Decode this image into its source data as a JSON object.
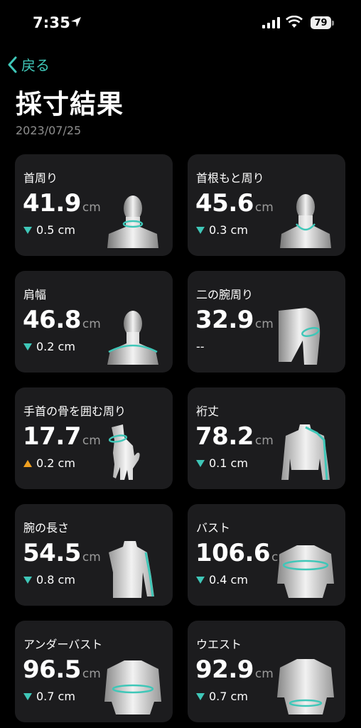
{
  "status_bar": {
    "time": "7:35",
    "battery": "79"
  },
  "nav": {
    "back_label": "戻る"
  },
  "page": {
    "title": "採寸結果",
    "date": "2023/07/25"
  },
  "colors": {
    "accent": "#3fc7b8",
    "up": "#f0a020",
    "card": "#1c1c1e"
  },
  "cards": [
    {
      "label": "首周り",
      "value": "41.9",
      "unit": "cm",
      "delta": "0.5 cm",
      "direction": "down",
      "figure": "head-neck"
    },
    {
      "label": "首根もと周り",
      "value": "45.6",
      "unit": "cm",
      "delta": "0.3 cm",
      "direction": "down",
      "figure": "head-neck-base"
    },
    {
      "label": "肩幅",
      "value": "46.8",
      "unit": "cm",
      "delta": "0.2 cm",
      "direction": "down",
      "figure": "head-shoulders"
    },
    {
      "label": "二の腕周り",
      "value": "32.9",
      "unit": "cm",
      "delta": "--",
      "direction": "none",
      "figure": "upper-arm"
    },
    {
      "label": "手首の骨を囲む周り",
      "value": "17.7",
      "unit": "cm",
      "delta": "0.2 cm",
      "direction": "up",
      "figure": "hand-wrist"
    },
    {
      "label": "裄丈",
      "value": "78.2",
      "unit": "cm",
      "delta": "0.1 cm",
      "direction": "down",
      "figure": "back-arm"
    },
    {
      "label": "腕の長さ",
      "value": "54.5",
      "unit": "cm",
      "delta": "0.8 cm",
      "direction": "down",
      "figure": "side-arm"
    },
    {
      "label": "バスト",
      "value": "106.6",
      "unit": "cm",
      "delta": "0.4 cm",
      "direction": "down",
      "figure": "torso-chest"
    },
    {
      "label": "アンダーバスト",
      "value": "96.5",
      "unit": "cm",
      "delta": "0.7 cm",
      "direction": "down",
      "figure": "torso-under"
    },
    {
      "label": "ウエスト",
      "value": "92.9",
      "unit": "cm",
      "delta": "0.7 cm",
      "direction": "down",
      "figure": "torso-waist"
    }
  ]
}
